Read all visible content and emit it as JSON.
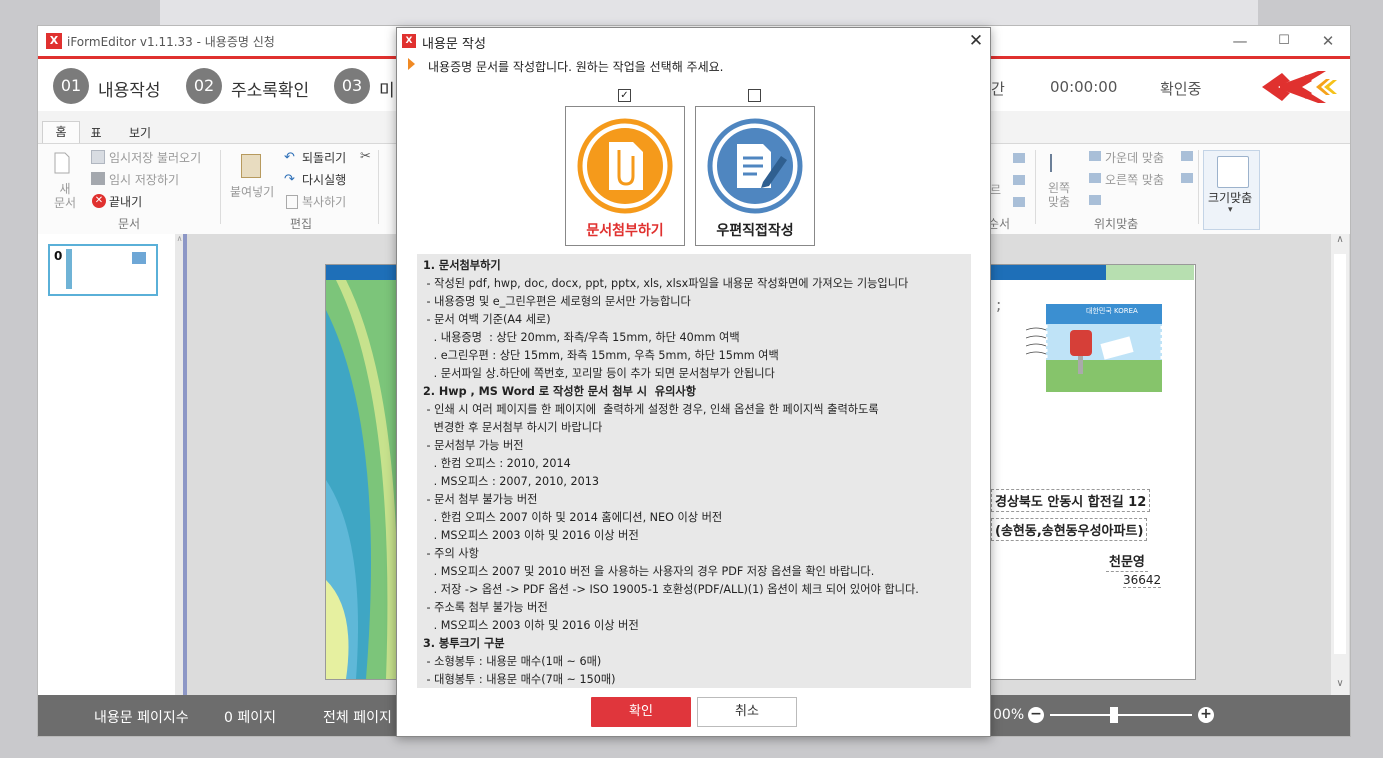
{
  "app": {
    "title": "iFormEditor v1.11.33 - 내용증명 신청",
    "logo_text": "X",
    "window_buttons": [
      "—",
      "☐",
      "✕"
    ]
  },
  "steps": [
    {
      "num": "01",
      "label": "내용작성"
    },
    {
      "num": "02",
      "label": "주소록확인"
    },
    {
      "num": "03",
      "label": "미"
    }
  ],
  "step_right": {
    "label_partial": "간",
    "time": "00:00:00",
    "status": "확인중"
  },
  "ribbon": {
    "tabs": [
      "홈",
      "표",
      "보기"
    ],
    "active_tab": 0,
    "document": {
      "new_label": "새\n문서",
      "temp_load": "임시저장 불러오기",
      "temp_save": "임시 저장하기",
      "close": "끝내기",
      "group": "문서"
    },
    "edit": {
      "paste": "붙여넣기",
      "undo": "되돌리기",
      "redo": "다시실행",
      "copy": "복사하기",
      "group": "편집"
    },
    "position": {
      "left_align": "왼쪽\n맞춤",
      "center_align": "가운데 맞춤",
      "right_align": "오른쪽 맞춤",
      "group": "위치맞춤",
      "partial_left": "르",
      "partial_group": "순서"
    },
    "fit": {
      "label": "크기맞춤",
      "arrow": "▾"
    }
  },
  "thumbnail": {
    "page_label": "0"
  },
  "document_preview": {
    "address_line1": "경상북도 안동시 합전길 12",
    "address_line2": "(송현동,송현동우성아파트)",
    "recipient": "천문영",
    "postal_code": "36642",
    "stamp_text": "대한민국 KOREA",
    "mark_colon": ";"
  },
  "statusbar": {
    "pages_label": "내용문 페이지수",
    "pages_value": "0 페이지",
    "total_label": "전체 페이지",
    "zoom": "00%",
    "zoom_out": "−",
    "zoom_in": "+",
    "zoom_level": 0.45
  },
  "dialog": {
    "title": "내용문 작성",
    "close": "✕",
    "instruction": "내용증명 문서를 작성합니다. 원하는 작업을 선택해 주세요.",
    "options": [
      {
        "label": "문서첨부하기",
        "checked": true,
        "check": "✓",
        "color": "#e0312f"
      },
      {
        "label": "우편직접작성",
        "checked": false,
        "check": "",
        "color": "#222222"
      }
    ],
    "info_lines": [
      {
        "text": "1. 문서첨부하기",
        "bold": true
      },
      {
        "text": " - 작성된 pdf, hwp, doc, docx, ppt, pptx, xls, xlsx파일을 내용문 작성화면에 가져오는 기능입니다",
        "bold": false
      },
      {
        "text": " - 내용증명 및 e_그린우편은 세로형의 문서만 가능합니다",
        "bold": false
      },
      {
        "text": " - 문서 여백 기준(A4 세로)",
        "bold": false
      },
      {
        "text": "   . 내용증명  : 상단 20mm, 좌측/우측 15mm, 하단 40mm 여백",
        "bold": false
      },
      {
        "text": "   . e그린우편 : 상단 15mm, 좌측 15mm, 우측 5mm, 하단 15mm 여백",
        "bold": false
      },
      {
        "text": "   . 문서파일 상.하단에 쪽번호, 꼬리말 등이 추가 되면 문서첨부가 안됩니다",
        "bold": false
      },
      {
        "text": "2. Hwp , MS Word 로 작성한 문서 첨부 시  유의사항",
        "bold": true
      },
      {
        "text": " - 인쇄 시 여러 페이지를 한 페이지에  출력하게 설정한 경우, 인쇄 옵션을 한 페이지씩 출력하도록",
        "bold": false
      },
      {
        "text": "   변경한 후 문서첨부 하시기 바랍니다",
        "bold": false
      },
      {
        "text": " - 문서첨부 가능 버전",
        "bold": false
      },
      {
        "text": "   . 한컴 오피스 : 2010, 2014",
        "bold": false
      },
      {
        "text": "   . MS오피스 : 2007, 2010, 2013",
        "bold": false
      },
      {
        "text": " - 문서 첨부 불가능 버전",
        "bold": false
      },
      {
        "text": "   . 한컴 오피스 2007 이하 및 2014 홈에디션, NEO 이상 버전",
        "bold": false
      },
      {
        "text": "   . MS오피스 2003 이하 및 2016 이상 버전",
        "bold": false
      },
      {
        "text": " - 주의 사항",
        "bold": false
      },
      {
        "text": "   . MS오피스 2007 및 2010 버전 을 사용하는 사용자의 경우 PDF 저장 옵션을 확인 바랍니다.",
        "bold": false
      },
      {
        "text": "   . 저장 -> 옵션 -> PDF 옵션 -> ISO 19005-1 호환성(PDF/ALL)(1) 옵션이 체크 되어 있어야 합니다.",
        "bold": false
      },
      {
        "text": " - 주소록 첨부 불가능 버전",
        "bold": false
      },
      {
        "text": "   . MS오피스 2003 이하 및 2016 이상 버전",
        "bold": false
      },
      {
        "text": "3. 봉투크기 구분",
        "bold": true
      },
      {
        "text": " - 소형봉투 : 내용문 매수(1매 ~ 6매)",
        "bold": false
      },
      {
        "text": " - 대형봉투 : 내용문 매수(7매 ~ 150매)",
        "bold": false
      }
    ],
    "ok_label": "확인",
    "cancel_label": "취소"
  },
  "colors": {
    "accent": "#e0312f",
    "orange": "#f59a1b",
    "blue": "#4f86c0",
    "status_bg": "#6d6d6d"
  }
}
